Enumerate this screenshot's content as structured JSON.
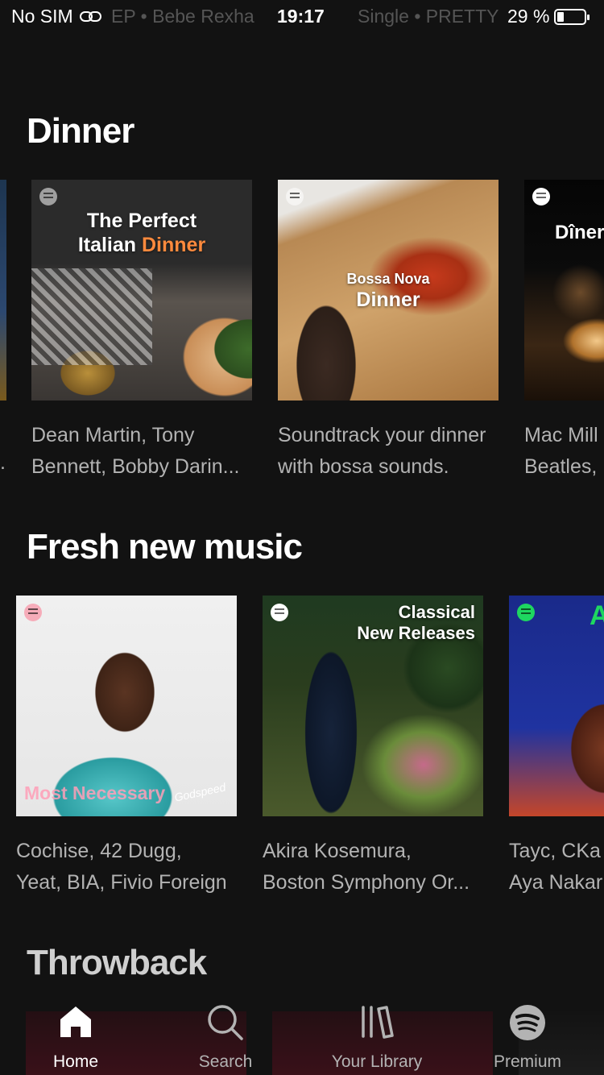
{
  "status_bar": {
    "carrier": "No SIM",
    "marquee_left": "EP • Bebe Rexha",
    "time": "19:17",
    "marquee_right": "Single • PRETTY",
    "battery": "29 %"
  },
  "sections": [
    {
      "title": "Dinner",
      "cards": [
        {
          "cover_line1": "The Perfect",
          "cover_line2a": "Italian ",
          "cover_line2b": "Dinner",
          "desc_line1": "Dean Martin, Tony",
          "desc_line2": "Bennett, Bobby Darin..."
        },
        {
          "cover_line1": "Bossa Nova",
          "cover_line2": "Dinner",
          "desc_line1": "Soundtrack your dinner",
          "desc_line2": "with bossa sounds."
        },
        {
          "cover_line1": "Dîner",
          "desc_line1": "Mac Mill",
          "desc_line2": "Beatles,"
        }
      ]
    },
    {
      "title": "Fresh new music",
      "cards": [
        {
          "cover_caption": "Most Necessary",
          "cover_sig": "Godspeed",
          "desc_line1": "Cochise, 42 Dugg,",
          "desc_line2": "Yeat, BIA, Fivio Foreign"
        },
        {
          "cover_line1": "Classical",
          "cover_line2": "New Releases",
          "desc_line1": "Akira Kosemura,",
          "desc_line2": "Boston Symphony Or..."
        },
        {
          "cover_line1": "A",
          "desc_line1": "Tayc, CKa",
          "desc_line2": "Aya Nakar"
        }
      ]
    },
    {
      "title": "Throwback"
    }
  ],
  "tabbar": {
    "tabs": [
      {
        "label": "Home",
        "icon": "home-icon",
        "active": true
      },
      {
        "label": "Search",
        "icon": "search-icon",
        "active": false
      },
      {
        "label": "Your Library",
        "icon": "library-icon",
        "active": false
      },
      {
        "label": "Premium",
        "icon": "spotify-icon",
        "active": false
      }
    ]
  },
  "colors": {
    "background": "#121212",
    "text_secondary": "#b3b3b3",
    "accent_orange": "#ff8a3d",
    "spotify_green": "#1ed760"
  }
}
